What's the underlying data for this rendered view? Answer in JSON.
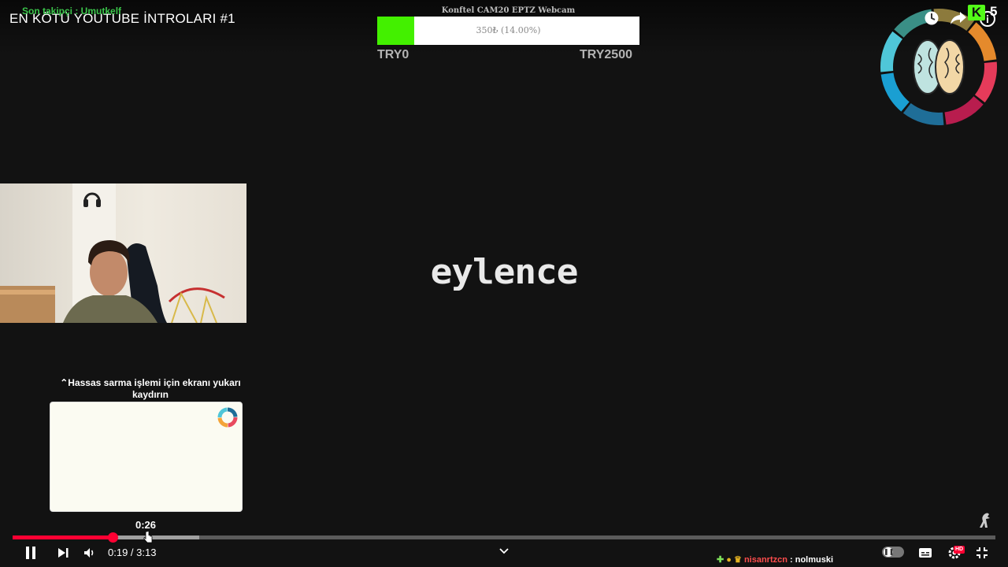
{
  "overlay": {
    "sub_alert": "Son takipçi : Umutkelf",
    "video_title": "EN KÖTÜ YOUTUBE İNTROLARI #1",
    "center_text": "eylence"
  },
  "donation_goal": {
    "title": "Konftel CAM20 EPTZ Webcam",
    "progress_text": "350₺ (14.00%)",
    "progress_fraction": 0.14,
    "min_label": "TRY0",
    "max_label": "TRY2500",
    "fill_color": "#43f000"
  },
  "kick": {
    "logo": "K",
    "count": "5"
  },
  "seek": {
    "hint": "Hassas sarma işlemi için ekranı yukarı kaydırın",
    "hint_icon": "double-chevron-up-icon",
    "preview_time": "0:26"
  },
  "player": {
    "current_time": "0:19",
    "separator": " / ",
    "duration": "3:13",
    "played_fraction": 0.102,
    "buffered_fraction": 0.19,
    "accent_color": "#ff0033",
    "hd_badge": "HD"
  },
  "chat": {
    "username": "nisanrtzcn",
    "separator": " : ",
    "message": "nolmuski"
  }
}
